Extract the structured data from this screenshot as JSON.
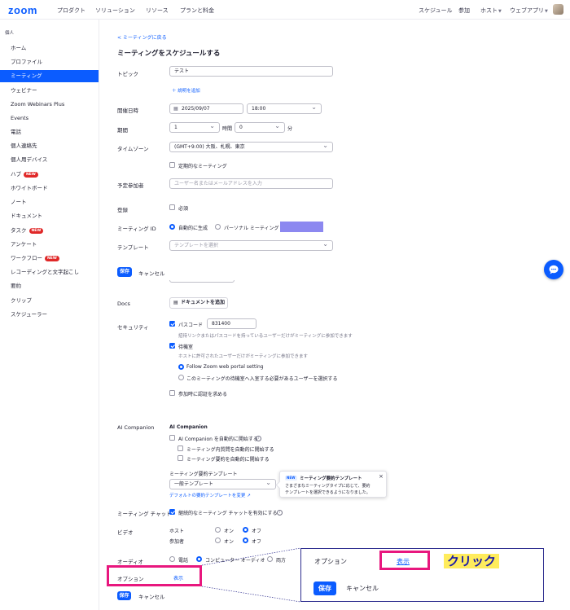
{
  "nav": {
    "logo": "zoom",
    "links": [
      "プロダクト",
      "ソリューション",
      "リソース",
      "プランと料金"
    ],
    "right": [
      "スケジュール",
      "参加",
      "ホスト",
      "ウェブアプリ"
    ]
  },
  "sidebar": {
    "heading": "個人",
    "items": [
      {
        "label": "ホーム"
      },
      {
        "label": "プロファイル"
      },
      {
        "label": "ミーティング",
        "active": true
      },
      {
        "label": "ウェビナー"
      },
      {
        "label": "Zoom Webinars Plus"
      },
      {
        "label": "Events"
      },
      {
        "label": "電話"
      },
      {
        "label": "個人連絡先"
      },
      {
        "label": "個人用デバイス"
      },
      {
        "label": "ハブ",
        "badge": "NEW"
      },
      {
        "label": "ホワイトボード"
      },
      {
        "label": "ノート"
      },
      {
        "label": "ドキュメント"
      },
      {
        "label": "タスク",
        "badge": "NEW"
      },
      {
        "label": "アンケート"
      },
      {
        "label": "ワークフロー",
        "badge": "NEW"
      },
      {
        "label": "レコーディングと文字起こし"
      },
      {
        "label": "要約"
      },
      {
        "label": "クリップ"
      },
      {
        "label": "スケジューラー"
      }
    ]
  },
  "form": {
    "back_link": "< ミーティングに戻る",
    "title": "ミーティングをスケジュールする",
    "topic_label": "トピック",
    "topic_value": "テスト",
    "add_description": "＋ 説明を追加",
    "when_label": "開催日時",
    "date_value": "2025/09/07",
    "time_value": "18:00",
    "duration_label": "期間",
    "duration_hours": "1",
    "hours_unit": "時間",
    "duration_minutes": "0",
    "minutes_unit": "分",
    "timezone_label": "タイムゾーン",
    "timezone_value": "(GMT+9:00) 大阪、札幌、東京",
    "recurring_label": "定期的なミーティング",
    "attendees_label": "予定参加者",
    "attendees_placeholder": "ユーザー名またはメールアドレスを入力",
    "registration_label": "登録",
    "registration_required": "必須",
    "meeting_id_label": "ミーティング ID",
    "meeting_id_auto": "自動的に生成",
    "meeting_id_personal": "パーソナル ミーティング ID",
    "template_label": "テンプレート",
    "template_placeholder": "テンプレートを選択",
    "save": "保存",
    "cancel": "キャンセル",
    "docs_label": "Docs",
    "add_docs_button": "ドキュメントを追加",
    "security_label": "セキュリティ",
    "passcode_label": "パスコード",
    "passcode_value": "831400",
    "passcode_help": "招待リンクまたはパスコードを持っているユーザーだけがミーティングに参加できます",
    "waiting_room_label": "待機室",
    "waiting_room_help": "ホストに許可されたユーザーだけがミーティングに参加できます",
    "waiting_opt1": "Follow Zoom web portal setting",
    "waiting_opt2": "このミーティングの待機室へ入室する必要があるユーザーを選択する",
    "auth_label": "参加時に認証を求める",
    "ai_label": "AI Companion",
    "ai_heading": "AI Companion",
    "ai_auto_start": "AI Companion を自動的に開始する",
    "ai_sub1": "ミーティング内質問を自動的に開始する",
    "ai_sub2": "ミーティング要約を自動的に開始する",
    "summary_template_label": "ミーティング要約テンプレート",
    "summary_template_value": "一般テンプレート",
    "summary_template_link": "デフォルトの要約テンプレートを変更 ↗",
    "chat_label": "ミーティング チャット",
    "chat_option": "継続的なミーティング チャットを有効にする",
    "video_label": "ビデオ",
    "video_host": "ホスト",
    "video_participant": "参加者",
    "on": "オン",
    "off": "オフ",
    "audio_label": "オーディオ",
    "audio_phone": "電話",
    "audio_computer": "コンピューター オーディオ",
    "audio_both": "両方",
    "options_label": "オプション",
    "options_show": "表示"
  },
  "popover": {
    "badge": "NEW",
    "title": "ミーティング要約テンプレート",
    "body_line1": "さまざまなミーティングタイプに応じて、要約",
    "body_line2": "テンプレートを選択できるようになりました。",
    "close": "×"
  },
  "callout": {
    "options_label": "オプション",
    "show_label": "表示",
    "click_label": "クリック",
    "save": "保存",
    "cancel": "キャンセル"
  },
  "colors": {
    "brand": "#0b5cff",
    "highlight": "#e8177e",
    "callout_border": "#2e2e8f",
    "click_bg": "#ffec5c",
    "redacted": "#8c88f0"
  }
}
